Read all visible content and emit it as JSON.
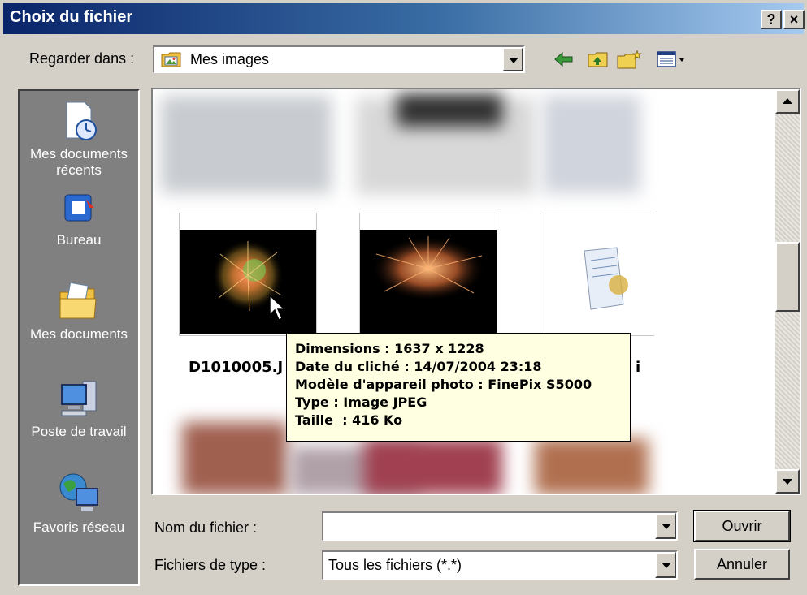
{
  "window": {
    "title": "Choix du fichier",
    "help_btn": "?",
    "close_btn": "×"
  },
  "lookin": {
    "label": "Regarder dans :",
    "value": "Mes images",
    "icon": "my-pictures-folder-icon"
  },
  "toolbar": {
    "icons": [
      "back-arrow-icon",
      "up-folder-icon",
      "new-folder-icon",
      "view-menu-icon"
    ]
  },
  "places": [
    {
      "label_line1": "Mes documents",
      "label_line2": "récents",
      "icon": "recent-documents-icon"
    },
    {
      "label_line1": "Bureau",
      "label_line2": "",
      "icon": "desktop-icon"
    },
    {
      "label_line1": "Mes documents",
      "label_line2": "",
      "icon": "my-documents-icon"
    },
    {
      "label_line1": "Poste de travail",
      "label_line2": "",
      "icon": "my-computer-icon"
    },
    {
      "label_line1": "Favoris réseau",
      "label_line2": "",
      "icon": "network-places-icon"
    }
  ],
  "files": {
    "item1_name": "D1010005.J",
    "item3_name_fragment": "i"
  },
  "tooltip": {
    "line1": "Dimensions : 1637 x 1228",
    "line2": "Date du cliché : 14/07/2004 23:18",
    "line3": "Modèle d'appareil photo : FinePix S5000",
    "line4": "Type : Image JPEG",
    "line5": "Taille  : 416 Ko"
  },
  "filename": {
    "label": "Nom du fichier :",
    "value": ""
  },
  "filetype": {
    "label": "Fichiers de type :",
    "value": "Tous les fichiers (*.*)"
  },
  "buttons": {
    "open": "Ouvrir",
    "cancel": "Annuler"
  },
  "colors": {
    "titlebar_start": "#0a246a",
    "titlebar_end": "#a6caf0",
    "dialog_bg": "#d4d0c8",
    "tooltip_bg": "#ffffe1"
  }
}
